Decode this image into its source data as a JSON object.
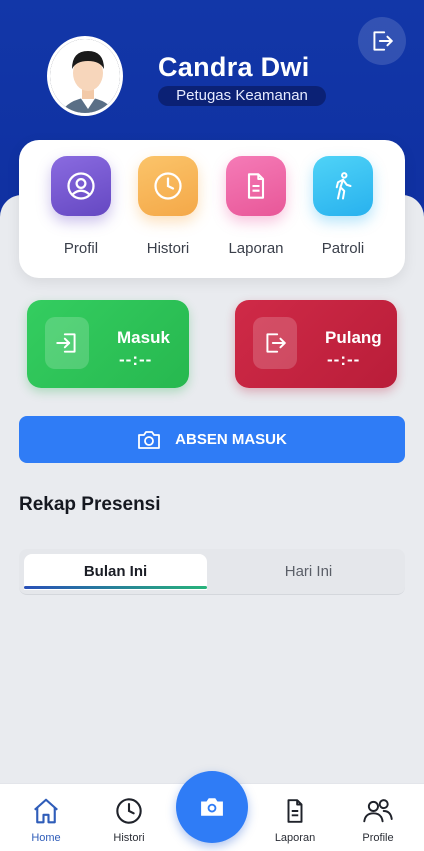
{
  "profile": {
    "name": "Candra Dwi",
    "role": "Petugas Keamanan",
    "avatar_icon": "user-avatar-icon"
  },
  "header": {
    "logout_icon": "logout-icon"
  },
  "menu": [
    {
      "label": "Profil",
      "icon": "profile-icon",
      "color": "#7a5bd0"
    },
    {
      "label": "Histori",
      "icon": "clock-icon",
      "color": "#f7b955"
    },
    {
      "label": "Laporan",
      "icon": "document-icon",
      "color": "#f06aa8"
    },
    {
      "label": "Patroli",
      "icon": "walk-icon",
      "color": "#3cc3f3"
    }
  ],
  "attendance": {
    "masuk": {
      "label": "Masuk",
      "time": "--:--",
      "color": "#2ec55a"
    },
    "pulang": {
      "label": "Pulang",
      "time": "--:--",
      "color": "#c8233f"
    }
  },
  "absen_button": {
    "label": "ABSEN MASUK"
  },
  "rekap": {
    "title": "Rekap Presensi",
    "tabs": [
      {
        "label": "Bulan Ini",
        "active": true
      },
      {
        "label": "Hari Ini",
        "active": false
      }
    ]
  },
  "bottom_nav": [
    {
      "label": "Home",
      "icon": "home-icon",
      "active": true
    },
    {
      "label": "Histori",
      "icon": "clock-icon",
      "active": false
    },
    {
      "label": "",
      "icon": "camera-icon",
      "active": false
    },
    {
      "label": "Laporan",
      "icon": "document-icon",
      "active": false
    },
    {
      "label": "Profile",
      "icon": "users-icon",
      "active": false
    }
  ]
}
